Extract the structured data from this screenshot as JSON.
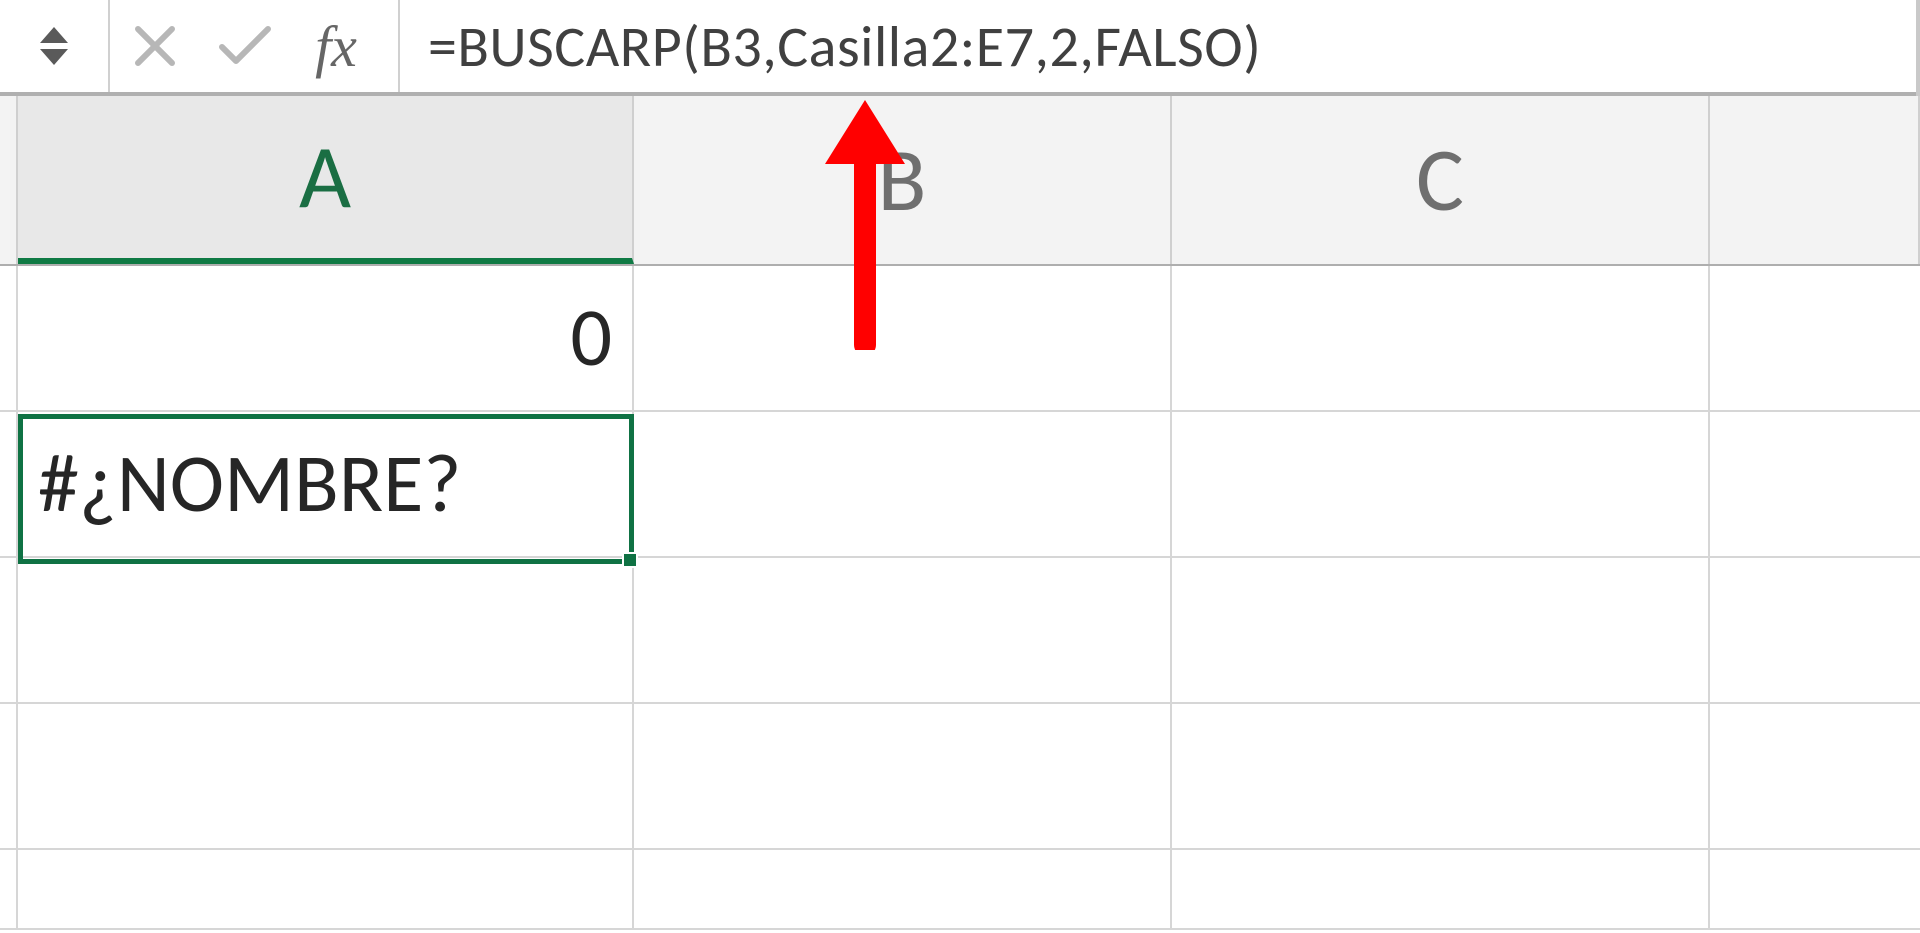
{
  "formula_bar": {
    "fx_label": "fx",
    "formula": "=BUSCARP(B3,Casilla2:E7,2,FALSO)"
  },
  "columns": {
    "A": "A",
    "B": "B",
    "C": "C"
  },
  "cells": {
    "A1": "0",
    "A2": "#¿NOMBRE?"
  },
  "selected_cell": "A2",
  "annotation": {
    "type": "arrow-up",
    "color": "#ff0000"
  }
}
